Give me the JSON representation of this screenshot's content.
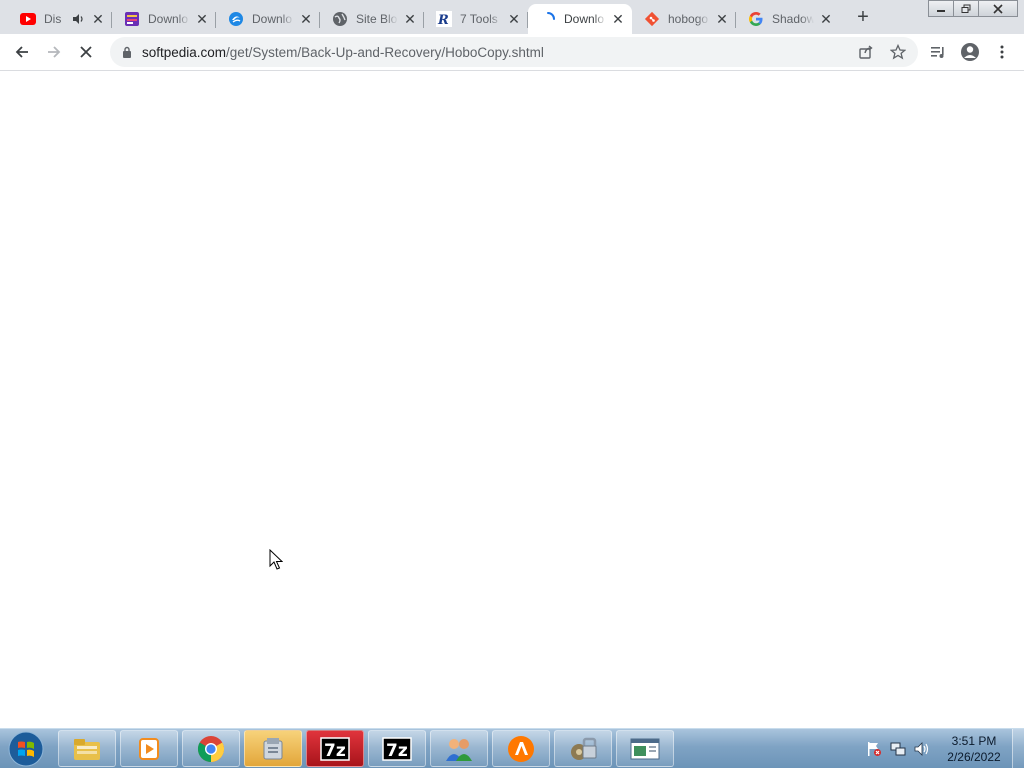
{
  "browser": {
    "tabs": [
      {
        "title": "Dis",
        "favicon": "youtube-icon",
        "audio": true,
        "active": false
      },
      {
        "title": "Downlo",
        "favicon": "download-site-icon",
        "active": false
      },
      {
        "title": "Downlo",
        "favicon": "download-blue-icon",
        "active": false
      },
      {
        "title": "Site Blo",
        "favicon": "globe-icon",
        "active": false
      },
      {
        "title": "7 Tools",
        "favicon": "r-logo-icon",
        "active": false
      },
      {
        "title": "Downlo",
        "favicon": "loading-spinner-icon",
        "active": true
      },
      {
        "title": "hobogo",
        "favicon": "git-icon",
        "active": false
      },
      {
        "title": "Shadow",
        "favicon": "google-icon",
        "active": false
      }
    ],
    "new_tab_symbol": "+",
    "url": {
      "domain": "softpedia.com",
      "path": "/get/System/Back-Up-and-Recovery/HoboCopy.shtml"
    }
  },
  "taskbar": {
    "clock_time": "3:51 PM",
    "clock_date": "2/26/2022",
    "pinned": [
      "windows-explorer-icon",
      "media-player-icon",
      "chrome-icon",
      "archive-manager-icon",
      "7zip-icon",
      "7zip-icon",
      "users-icon",
      "avast-icon",
      "security-settings-icon",
      "window-app-icon"
    ]
  },
  "colors": {
    "tabstrip": "#dee1e6",
    "omnibox": "#f1f3f4",
    "taskbar": "#7fa3c4",
    "youtube_red": "#ff0000",
    "chrome_blue": "#1a73e8"
  }
}
